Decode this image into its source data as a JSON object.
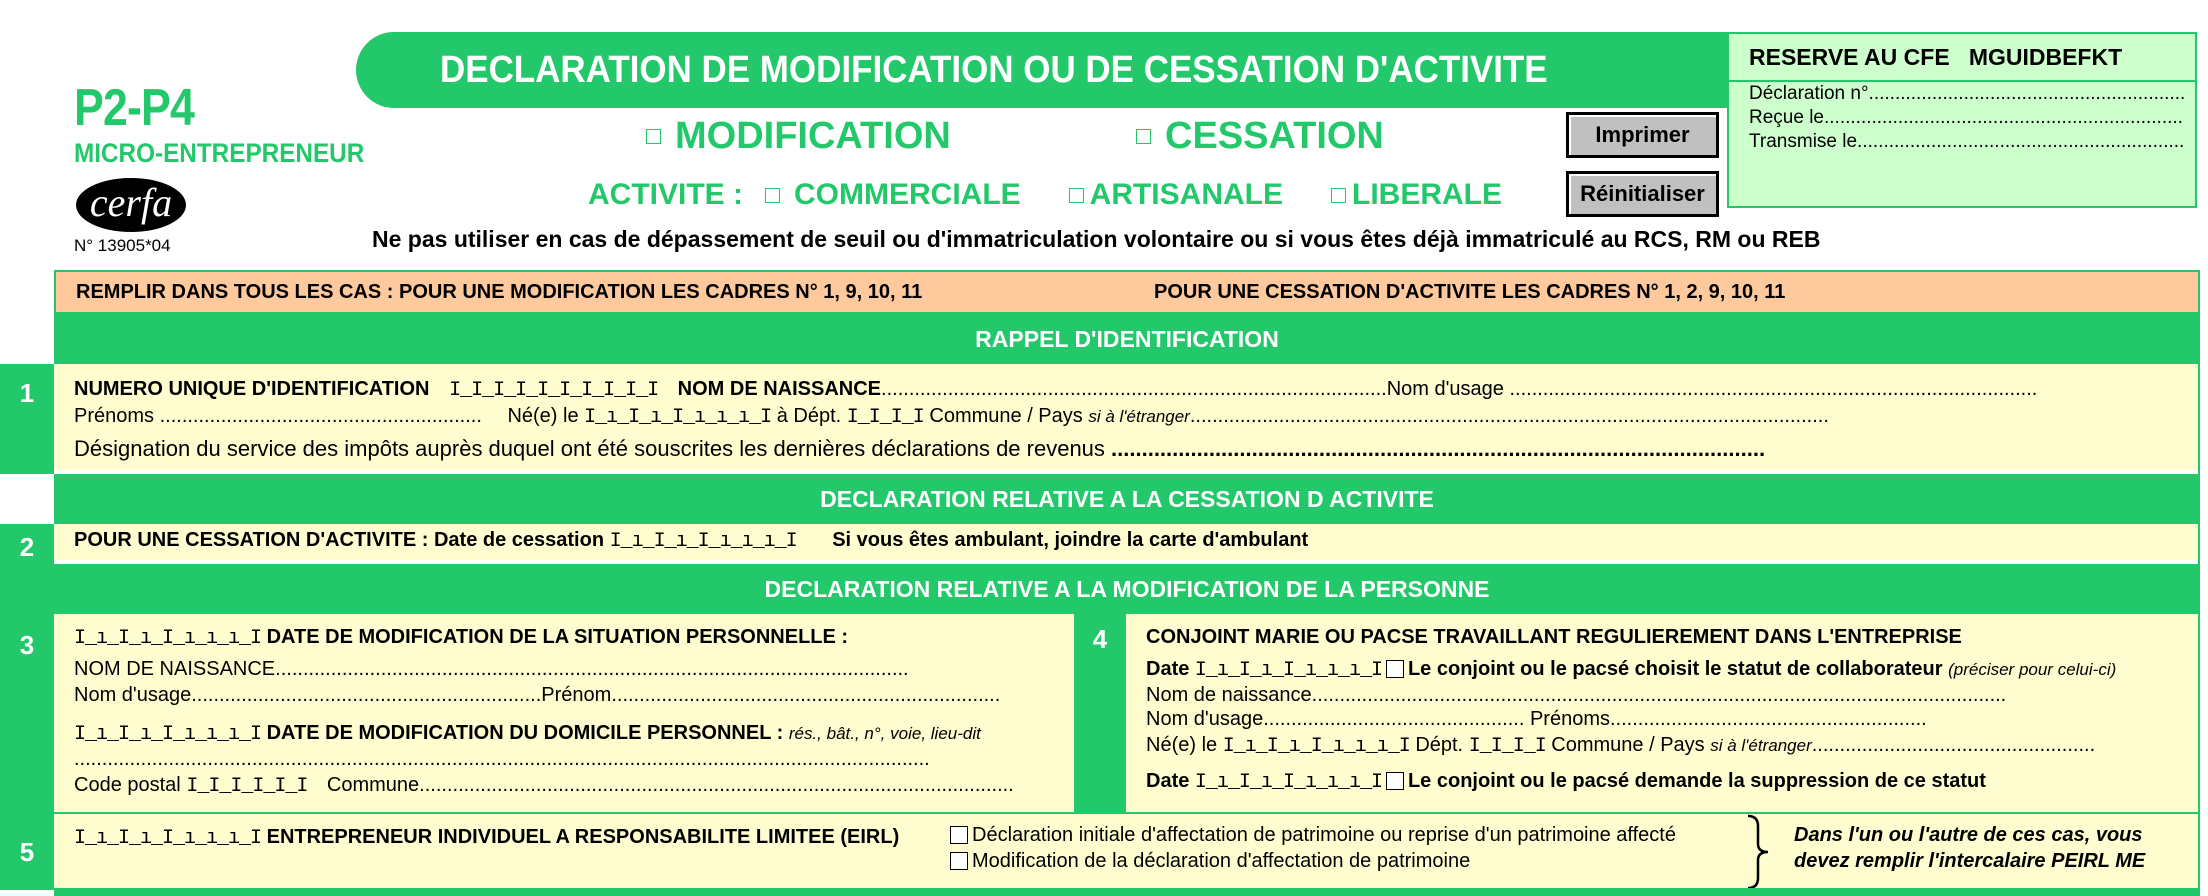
{
  "header": {
    "form_code": "P2-P4",
    "subtitle": "MICRO-ENTREPRENEUR",
    "logo_text": "cerfa",
    "cerfa_number": "N° 13905*04",
    "title": "DECLARATION DE MODIFICATION OU DE CESSATION  D'ACTIVITE",
    "type_options": [
      {
        "label": "MODIFICATION",
        "checked": false
      },
      {
        "label": "CESSATION",
        "checked": false
      }
    ],
    "activite_label": "ACTIVITE :",
    "activite_options": [
      {
        "label": "COMMERCIALE",
        "checked": false
      },
      {
        "label": "ARTISANALE",
        "checked": false
      },
      {
        "label": "LIBERALE",
        "checked": false
      }
    ],
    "warning": "Ne pas utiliser en cas de dépassement de seuil ou d'immatriculation volontaire ou si vous êtes déjà immatriculé au RCS, RM ou REB"
  },
  "buttons": {
    "print": "Imprimer",
    "reset": "Réinitialiser"
  },
  "cfe_box": {
    "title": "RESERVE AU CFE   MGUIDBEFKT",
    "lines": [
      "Déclaration n°............................................................",
      "Reçue le.......................................................................",
      "Transmise le................................................................"
    ]
  },
  "instructions": {
    "left": "REMPLIR DANS TOUS LES CAS : POUR UNE MODIFICATION LES CADRES N° 1, 9, 10, 11",
    "right": "POUR UNE CESSATION D'ACTIVITE LES CADRES N° 1, 2, 9, 10, 11"
  },
  "sections": {
    "rappel": "RAPPEL D'IDENTIFICATION",
    "cessation": "DECLARATION RELATIVE A LA CESSATION D ACTIVITE",
    "modification": "DECLARATION RELATIVE A LA MODIFICATION DE LA PERSONNE"
  },
  "grids": {
    "siren": "I_I_I_I_I_I_I_I_I_I",
    "date": "I_ı_I_ı_I_ı_ı_ı_I",
    "dept": "I_I_I_I",
    "postal": "I_I_I_I_I_I"
  },
  "cadre1": {
    "number": "1",
    "siren_label": "NUMERO UNIQUE D'IDENTIFICATION",
    "nom_naissance": "NOM DE NAISSANCE",
    "nom_naissance_dots": "...........................................................................................",
    "nom_usage": "Nom d'usage",
    "nom_usage_dots": " ...............................................................................................",
    "prenoms": "Prénoms",
    "prenoms_dots": " ..........................................................",
    "ne_le": "Né(e)  le",
    "a_dept": "à Dépt.",
    "commune_pays": "Commune / Pays",
    "si_etranger": "si à l'étranger",
    "commune_dots": "...................................................................................................................",
    "designation": "Désignation du service des impôts auprès duquel ont été souscrites les dernières déclarations de revenus",
    "designation_dots": " ..........................................................................................................."
  },
  "cadre2": {
    "number": "2",
    "label": "POUR UNE CESSATION D'ACTIVITE : Date de cessation",
    "ambulant": "Si vous êtes ambulant, joindre la carte d'ambulant"
  },
  "cadre3": {
    "number": "3",
    "date_situation": "DATE DE MODIFICATION DE LA SITUATION PERSONNELLE :",
    "nom_naissance": "NOM DE NAISSANCE",
    "nom_naissance_dots": "..................................................................................................................",
    "nom_usage": "Nom d'usage",
    "nom_usage_dots": "...............................................................",
    "prenom": "Prénom",
    "prenom_dots": "......................................................................",
    "date_domicile": "DATE DE MODIFICATION DU DOMICILE PERSONNEL :",
    "domicile_hint": "rés., bât., n°, voie, lieu-dit",
    "address_dots": "..........................................................................................................................................................",
    "code_postal": "Code postal",
    "commune": "Commune",
    "commune_dots": "..........................................................................................................."
  },
  "cadre4": {
    "number": "4",
    "title": "CONJOINT MARIE OU PACSE TRAVAILLANT REGULIEREMENT DANS L'ENTREPRISE",
    "date": "Date",
    "choice_collab": "Le conjoint ou le pacsé choisit le statut de collaborateur",
    "choice_collab_hint": "(préciser pour celui-ci)",
    "nom_naissance": "Nom de  naissance",
    "nom_naissance_dots": ".............................................................................................................................",
    "nom_usage": "Nom d'usage",
    "nom_usage_dots": "...............................................",
    "prenoms": "Prénoms",
    "prenoms_dots": ".........................................................",
    "ne_le": "Né(e) le",
    "dept": "Dépt.",
    "commune_pays": "Commune / Pays",
    "si_etranger": "si à l'étranger",
    "commune_dots": "...................................................",
    "choice_suppr": "Le conjoint ou le pacsé demande la suppression de ce statut"
  },
  "cadre5": {
    "number": "5",
    "label": "ENTREPRENEUR INDIVIDUEL A RESPONSABILITE LIMITEE (EIRL)",
    "option1": "Déclaration initiale d'affectation de patrimoine ou reprise d'un patrimoine affecté",
    "option2": "Modification de la déclaration d'affectation de patrimoine",
    "note_line1": "Dans l'un ou l'autre de ces cas, vous",
    "note_line2": "devez remplir l'intercalaire PEIRL ME"
  }
}
